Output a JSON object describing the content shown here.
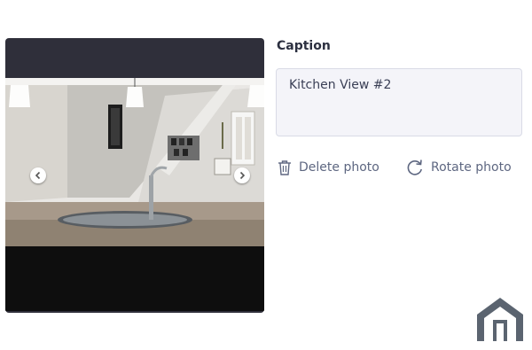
{
  "gallery": {
    "photo_alt": "Kitchen with granite counter, sink and pendant lights",
    "prev_icon": "chevron-left-icon",
    "next_icon": "chevron-right-icon"
  },
  "caption": {
    "label": "Caption",
    "value": "Kitchen View #2"
  },
  "actions": {
    "delete_label": "Delete photo",
    "delete_icon": "trash-icon",
    "rotate_label": "Rotate photo",
    "rotate_icon": "rotate-icon"
  },
  "colors": {
    "viewer_bg": "#2f2f3a",
    "action_text": "#5e6781",
    "input_bg": "#f4f4f9",
    "logo": "#5b6470"
  }
}
